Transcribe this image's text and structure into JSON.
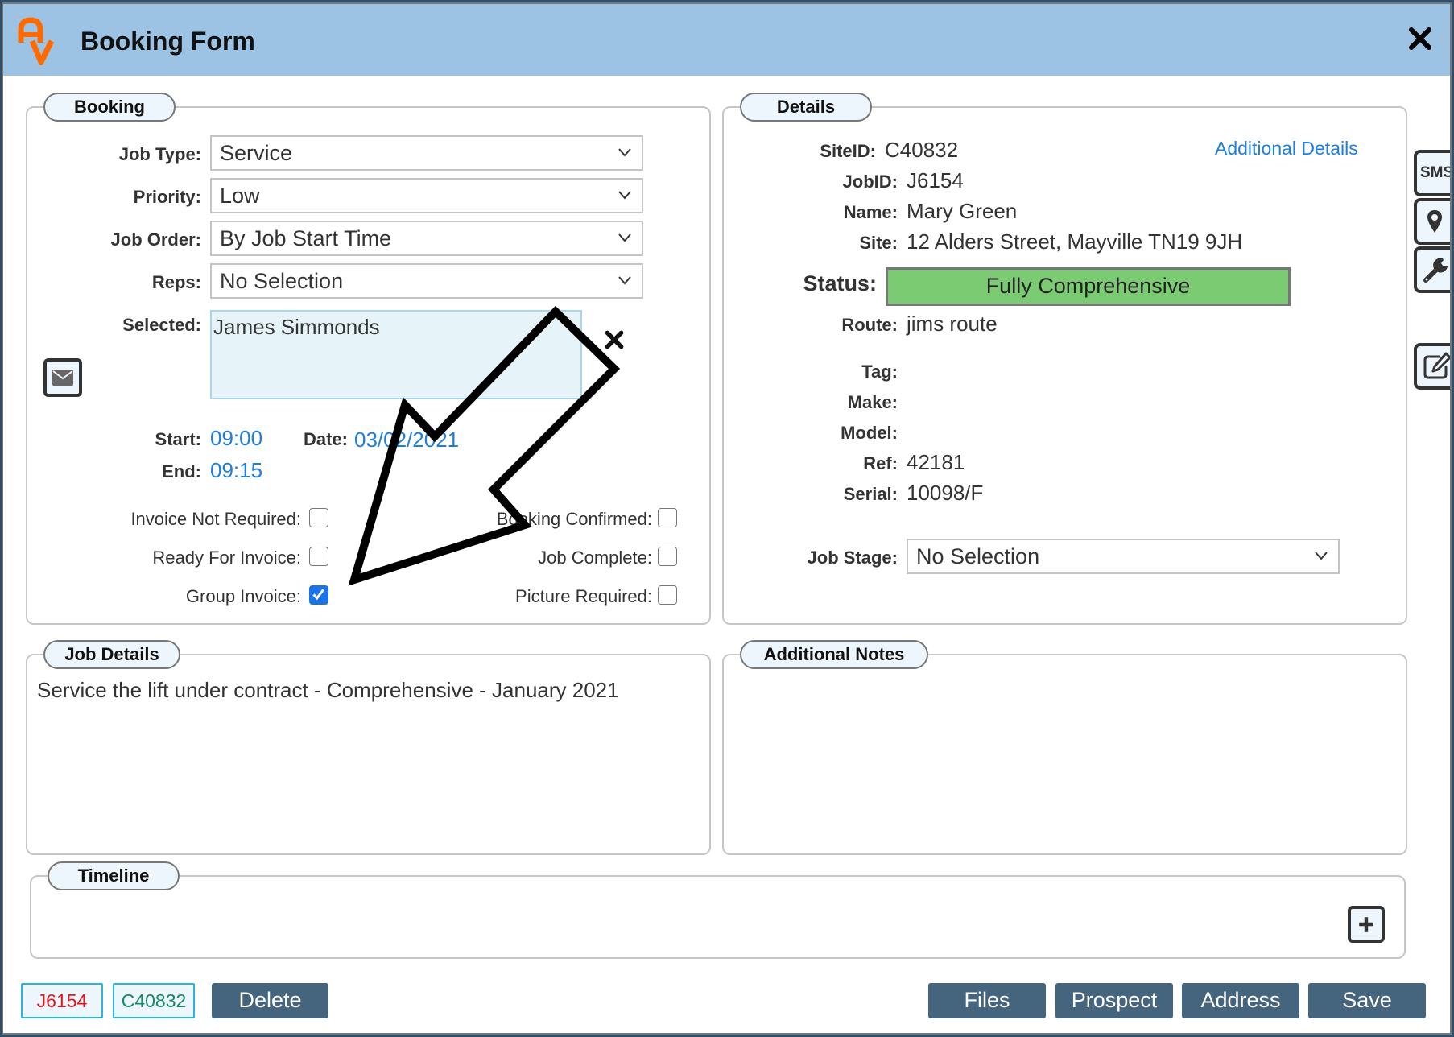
{
  "window": {
    "title": "Booking Form",
    "logo_letters": "AV",
    "colors": {
      "header": "#9cc3e3",
      "accent_orange": "#ff6a00",
      "status_green": "#7bcb72",
      "button_dark": "#45647e",
      "link_blue": "#1e7fe0"
    }
  },
  "booking": {
    "legend": "Booking",
    "job_type": {
      "label": "Job Type:",
      "value": "Service"
    },
    "priority": {
      "label": "Priority:",
      "value": "Low"
    },
    "job_order": {
      "label": "Job Order:",
      "value": "By Job Start Time"
    },
    "reps": {
      "label": "Reps:",
      "value": "No Selection"
    },
    "selected": {
      "label": "Selected:",
      "value": "James Simmonds"
    },
    "start": {
      "label": "Start:",
      "value": "09:00"
    },
    "end": {
      "label": "End:",
      "value": "09:15"
    },
    "date": {
      "label": "Date:",
      "value": "03/02/2021"
    },
    "checkboxes": [
      {
        "label": "Invoice Not Required:",
        "checked": false
      },
      {
        "label": "Ready For Invoice:",
        "checked": false
      },
      {
        "label": "Group Invoice:",
        "checked": true
      },
      {
        "label": "Booking Confirmed:",
        "checked": false
      },
      {
        "label": "Job Complete:",
        "checked": false
      },
      {
        "label": "Picture Required:",
        "checked": false
      }
    ]
  },
  "details": {
    "legend": "Details",
    "additional_details_link": "Additional Details",
    "site_id": {
      "label": "SiteID:",
      "value": "C40832"
    },
    "job_id": {
      "label": "JobID:",
      "value": "J6154"
    },
    "name": {
      "label": "Name:",
      "value": "Mary Green"
    },
    "site": {
      "label": "Site:",
      "value": "12 Alders Street, Mayville TN19 9JH"
    },
    "status": {
      "label": "Status:",
      "value": "Fully Comprehensive"
    },
    "route": {
      "label": "Route:",
      "value": "jims route"
    },
    "tag": {
      "label": "Tag:",
      "value": ""
    },
    "make": {
      "label": "Make:",
      "value": ""
    },
    "model": {
      "label": "Model:",
      "value": ""
    },
    "ref": {
      "label": "Ref:",
      "value": "42181"
    },
    "serial": {
      "label": "Serial:",
      "value": "10098/F"
    },
    "job_stage": {
      "label": "Job Stage:",
      "value": "No Selection"
    }
  },
  "job_details": {
    "legend": "Job Details",
    "text": "Service the lift under contract - Comprehensive - January 2021"
  },
  "additional_notes": {
    "legend": "Additional Notes",
    "text": ""
  },
  "timeline": {
    "legend": "Timeline"
  },
  "side_toolbar": {
    "sms_label": "SMS"
  },
  "footer": {
    "job_tag": "J6154",
    "site_tag": "C40832",
    "delete_label": "Delete",
    "files_label": "Files",
    "prospect_label": "Prospect",
    "address_label": "Address",
    "save_label": "Save"
  }
}
